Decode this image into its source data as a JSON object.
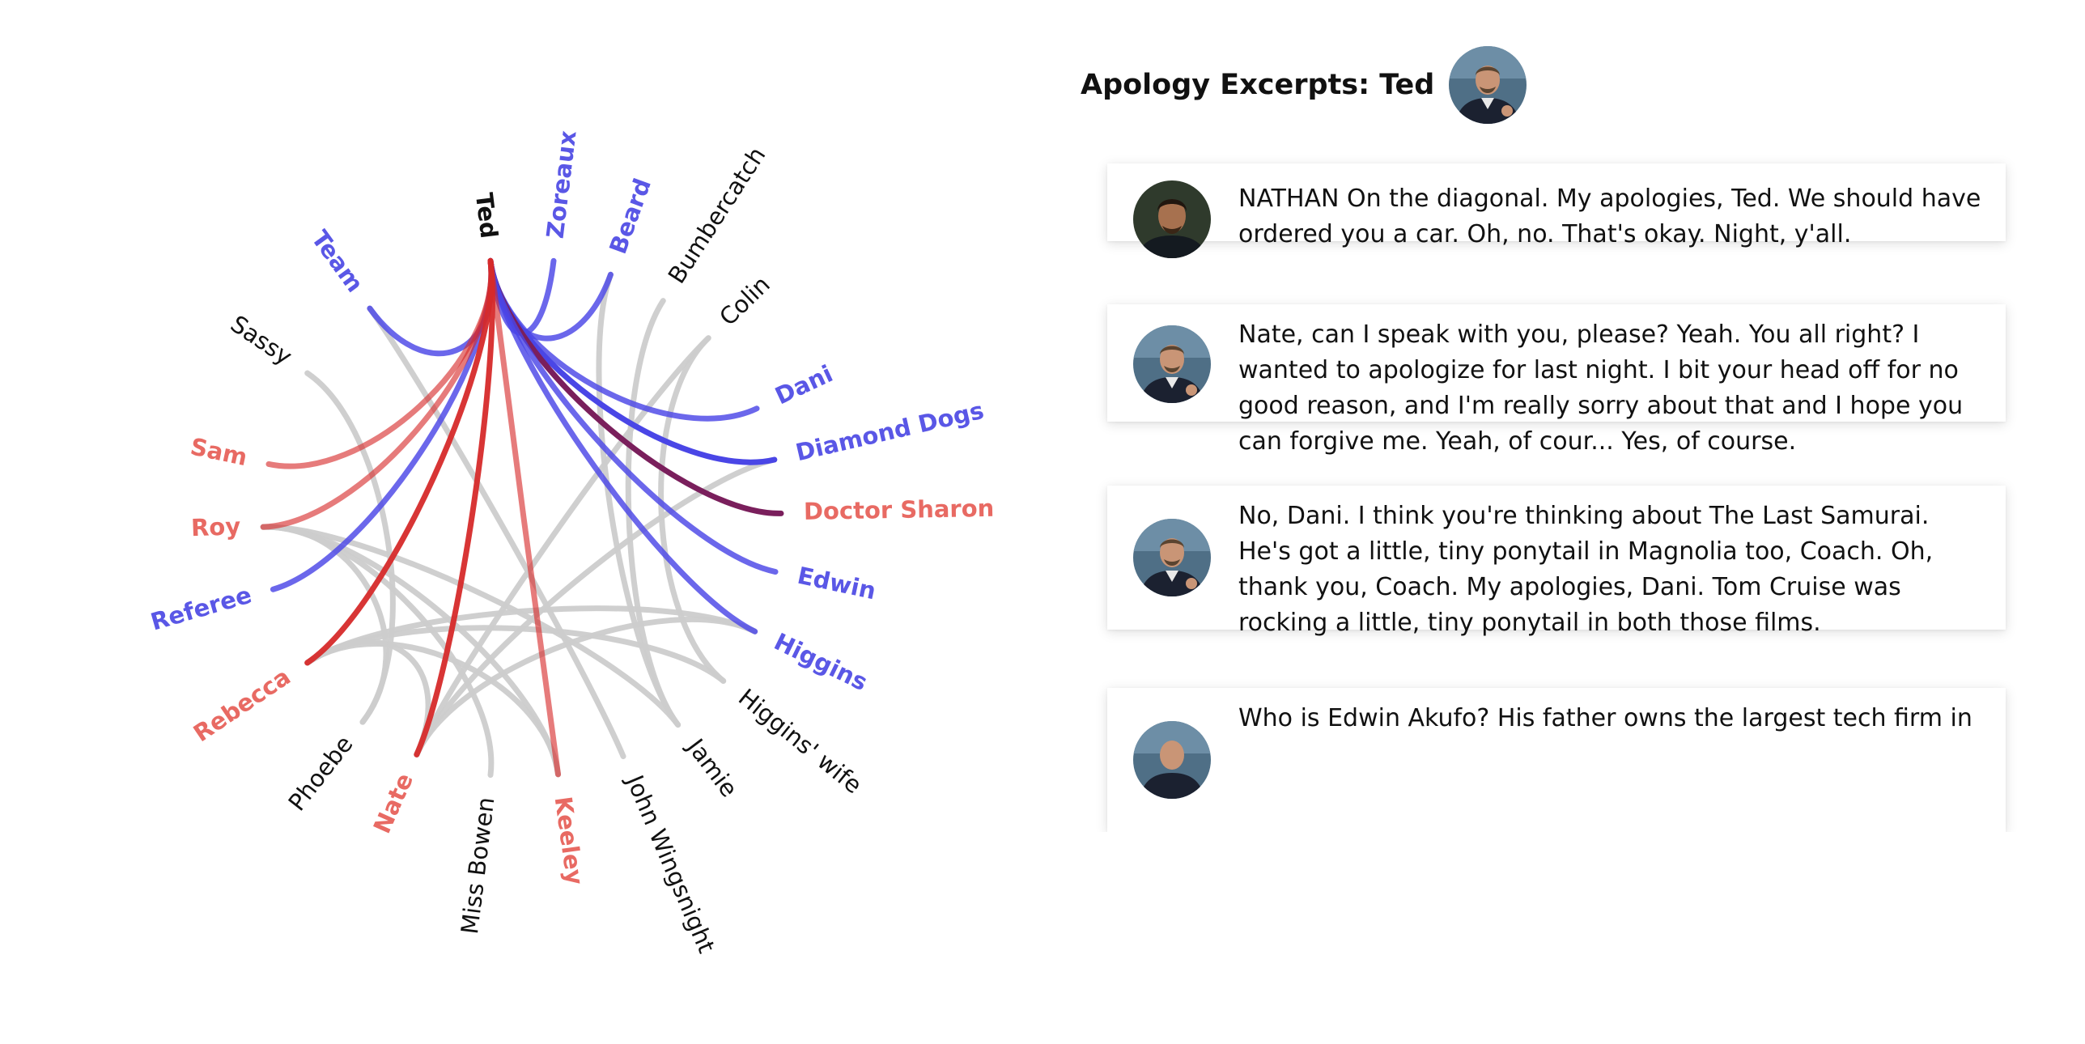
{
  "chart_data": {
    "type": "chord",
    "center": "Ted",
    "colors": {
      "blue": "#4a46e6",
      "red": "#d62a2a",
      "gray": "#cccccc",
      "purple": "#7a1f5c",
      "blue_label": "#5a57e6",
      "red_label": "#e86a63",
      "black_label": "#111111"
    },
    "nodes": [
      {
        "name": "Ted",
        "color": "black",
        "bold": true
      },
      {
        "name": "Zoreaux",
        "color": "blue"
      },
      {
        "name": "Beard",
        "color": "blue"
      },
      {
        "name": "Bumbercatch",
        "color": "black"
      },
      {
        "name": "Colin",
        "color": "black"
      },
      {
        "name": "Dani",
        "color": "blue"
      },
      {
        "name": "Diamond Dogs",
        "color": "blue"
      },
      {
        "name": "Doctor Sharon",
        "color": "red"
      },
      {
        "name": "Edwin",
        "color": "blue"
      },
      {
        "name": "Higgins",
        "color": "blue"
      },
      {
        "name": "Higgins' wife",
        "color": "black"
      },
      {
        "name": "Jamie",
        "color": "black"
      },
      {
        "name": "John Wingsnight",
        "color": "black"
      },
      {
        "name": "Keeley",
        "color": "red"
      },
      {
        "name": "Miss Bowen",
        "color": "black"
      },
      {
        "name": "Nate",
        "color": "red"
      },
      {
        "name": "Phoebe",
        "color": "black"
      },
      {
        "name": "Rebecca",
        "color": "red"
      },
      {
        "name": "Referee",
        "color": "blue"
      },
      {
        "name": "Roy",
        "color": "red"
      },
      {
        "name": "Sam",
        "color": "red"
      },
      {
        "name": "Sassy",
        "color": "black"
      },
      {
        "name": "Team",
        "color": "blue"
      }
    ],
    "links": [
      {
        "source": "Ted",
        "target": "Zoreaux",
        "color": "blue"
      },
      {
        "source": "Ted",
        "target": "Beard",
        "color": "blue"
      },
      {
        "source": "Ted",
        "target": "Dani",
        "color": "blue"
      },
      {
        "source": "Ted",
        "target": "Diamond Dogs",
        "color": "blue",
        "strong": true
      },
      {
        "source": "Ted",
        "target": "Doctor Sharon",
        "color": "purple"
      },
      {
        "source": "Ted",
        "target": "Edwin",
        "color": "blue"
      },
      {
        "source": "Ted",
        "target": "Higgins",
        "color": "blue"
      },
      {
        "source": "Ted",
        "target": "Team",
        "color": "blue"
      },
      {
        "source": "Ted",
        "target": "Referee",
        "color": "blue"
      },
      {
        "source": "Ted",
        "target": "Sam",
        "color": "red",
        "light": true
      },
      {
        "source": "Ted",
        "target": "Roy",
        "color": "red",
        "light": true
      },
      {
        "source": "Ted",
        "target": "Rebecca",
        "color": "red"
      },
      {
        "source": "Ted",
        "target": "Nate",
        "color": "red"
      },
      {
        "source": "Ted",
        "target": "Keeley",
        "color": "red",
        "light": true
      },
      {
        "source": "Beard",
        "target": "Jamie",
        "color": "gray"
      },
      {
        "source": "Bumbercatch",
        "target": "Jamie",
        "color": "gray"
      },
      {
        "source": "Colin",
        "target": "Nate",
        "color": "gray"
      },
      {
        "source": "Colin",
        "target": "Higgins' wife",
        "color": "gray"
      },
      {
        "source": "Diamond Dogs",
        "target": "Nate",
        "color": "gray"
      },
      {
        "source": "Higgins",
        "target": "Rebecca",
        "color": "gray"
      },
      {
        "source": "Higgins",
        "target": "Nate",
        "color": "gray"
      },
      {
        "source": "Roy",
        "target": "Jamie",
        "color": "gray"
      },
      {
        "source": "Roy",
        "target": "Miss Bowen",
        "color": "gray"
      },
      {
        "source": "Roy",
        "target": "Keeley",
        "color": "gray"
      },
      {
        "source": "Roy",
        "target": "Phoebe",
        "color": "gray"
      },
      {
        "source": "Rebecca",
        "target": "Keeley",
        "color": "gray"
      },
      {
        "source": "Rebecca",
        "target": "Higgins' wife",
        "color": "gray"
      },
      {
        "source": "Rebecca",
        "target": "Nate",
        "color": "gray"
      },
      {
        "source": "Sassy",
        "target": "Phoebe",
        "color": "gray"
      },
      {
        "source": "Team",
        "target": "John Wingsnight",
        "color": "gray"
      }
    ]
  },
  "panel": {
    "title": "Apology Excerpts: Ted",
    "excerpts": [
      {
        "speaker": "nathan-avatar",
        "text": "NATHAN On the diagonal. My apologies, Ted. We should have ordered you a car. Oh, no. That's okay. Night, y'all."
      },
      {
        "speaker": "ted-avatar",
        "text": "Nate, can I speak with you, please? Yeah. You all right? I wanted to apologize for last night. I bit your head off for no good reason, and I'm really sorry about that and I hope you can forgive me. Yeah, of cour... Yes, of course."
      },
      {
        "speaker": "ted-avatar",
        "text": "No, Dani. I think you're thinking about The Last Samurai. He's got a little, tiny ponytail in Magnolia too, Coach. Oh, thank you, Coach. My apologies, Dani. Tom Cruise was rocking a little, tiny ponytail in both those films."
      },
      {
        "speaker": "ted-avatar",
        "text": "Who is Edwin Akufo? His father owns the largest tech firm in"
      }
    ]
  }
}
